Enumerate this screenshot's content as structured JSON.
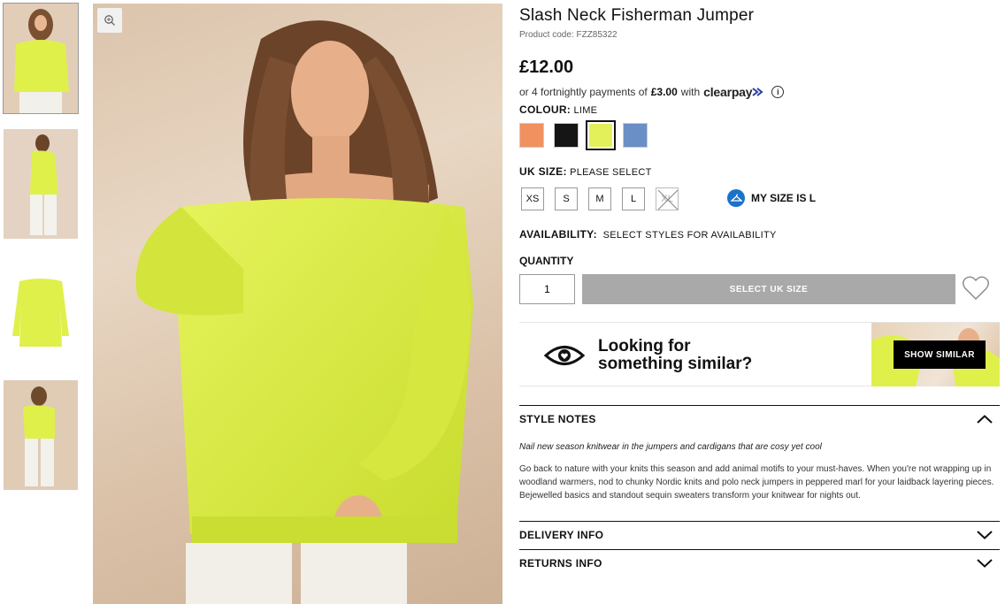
{
  "product": {
    "title": "Slash Neck Fisherman Jumper",
    "code": "Product code: FZZ85322",
    "price": "£12.00"
  },
  "clearpay": {
    "prefix": "or 4 fortnightly payments of",
    "amount": "£3.00",
    "with": "with",
    "logo": "clearpay",
    "info_icon": "info-icon"
  },
  "colour": {
    "label": "COLOUR:",
    "selected": "LIME",
    "swatches": [
      {
        "name": "orange",
        "hex": "#f0915f"
      },
      {
        "name": "black",
        "hex": "#151515"
      },
      {
        "name": "lime",
        "hex": "#e3f05a"
      },
      {
        "name": "blue",
        "hex": "#6a8fc6"
      }
    ]
  },
  "size": {
    "label": "UK SIZE:",
    "prompt": "PLEASE SELECT",
    "options": [
      "XS",
      "S",
      "M",
      "L",
      "XL"
    ],
    "out_of_stock": [
      "XL"
    ],
    "my_size": "MY SIZE IS L"
  },
  "availability": {
    "label": "AVAILABILITY:",
    "value": "SELECT STYLES FOR AVAILABILITY"
  },
  "quantity": {
    "label": "QUANTITY",
    "value": "1"
  },
  "add_button": "SELECT UK SIZE",
  "similar": {
    "line1": "Looking for",
    "line2": "something similar?",
    "button": "SHOW SIMILAR"
  },
  "style_notes": {
    "title": "STYLE NOTES",
    "lead": "Nail new season knitwear in the jumpers and cardigans that are cosy yet cool",
    "body": "Go back to nature with your knits this season and add animal motifs to your must-haves. When you're not wrapping up in woodland warmers, nod to chunky Nordic knits and polo neck jumpers in peppered marl for your laidback layering pieces. Bejewelled basics and standout sequin sweaters transform your knitwear for nights out."
  },
  "delivery_info": "DELIVERY INFO",
  "returns_info": "RETURNS INFO",
  "colors": {
    "lime": "#dff04a",
    "button_grey": "#a9a9a9",
    "size_icon_blue": "#1a73c9"
  }
}
